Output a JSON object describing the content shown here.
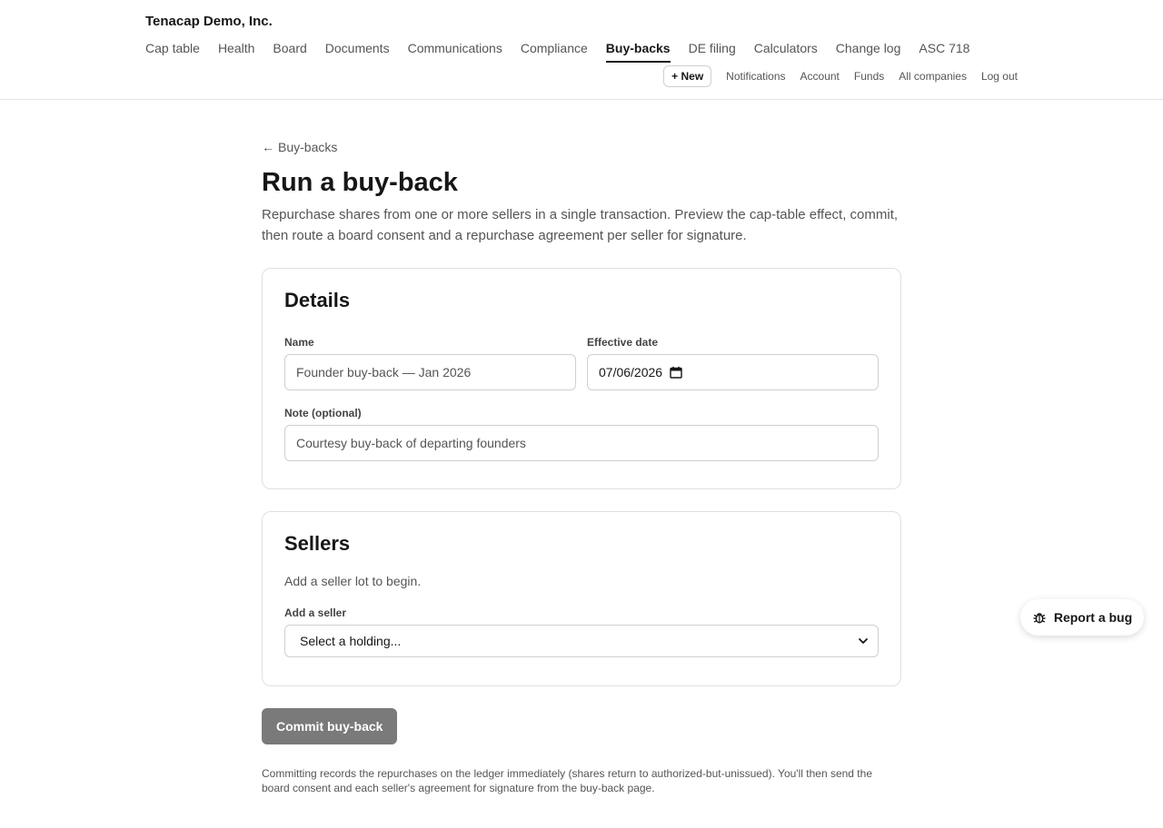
{
  "header": {
    "company_name": "Tenacap Demo, Inc.",
    "nav": [
      {
        "label": "Cap table",
        "active": false
      },
      {
        "label": "Health",
        "active": false
      },
      {
        "label": "Board",
        "active": false
      },
      {
        "label": "Documents",
        "active": false
      },
      {
        "label": "Communications",
        "active": false
      },
      {
        "label": "Compliance",
        "active": false
      },
      {
        "label": "Buy-backs",
        "active": true
      },
      {
        "label": "DE filing",
        "active": false
      },
      {
        "label": "Calculators",
        "active": false
      },
      {
        "label": "Change log",
        "active": false
      },
      {
        "label": "ASC 718",
        "active": false
      }
    ],
    "new_button": "+ New",
    "sub_links": [
      "Notifications",
      "Account",
      "Funds",
      "All companies",
      "Log out"
    ]
  },
  "main": {
    "back_link": "Buy-backs",
    "title": "Run a buy-back",
    "description": "Repurchase shares from one or more sellers in a single transaction. Preview the cap-table effect, commit, then route a board consent and a repurchase agreement per seller for signature.",
    "details": {
      "title": "Details",
      "name_label": "Name",
      "name_placeholder": "Founder buy-back — Jan 2026",
      "date_label": "Effective date",
      "date_value": "07/06/2026",
      "note_label": "Note (optional)",
      "note_placeholder": "Courtesy buy-back of departing founders"
    },
    "sellers": {
      "title": "Sellers",
      "empty_text": "Add a seller lot to begin.",
      "add_label": "Add a seller",
      "select_value": "Select a holding..."
    },
    "commit_button": "Commit buy-back",
    "footnote": "Committing records the repurchases on the ledger immediately (shares return to authorized-but-unissued). You'll then send the board consent and each seller's agreement for signature from the buy-back page."
  },
  "report_bug": "Report a bug",
  "icons": {
    "back": "arrow-left-icon",
    "calendar": "calendar-icon",
    "select": "chevron-down-icon",
    "bug": "bug-icon"
  }
}
